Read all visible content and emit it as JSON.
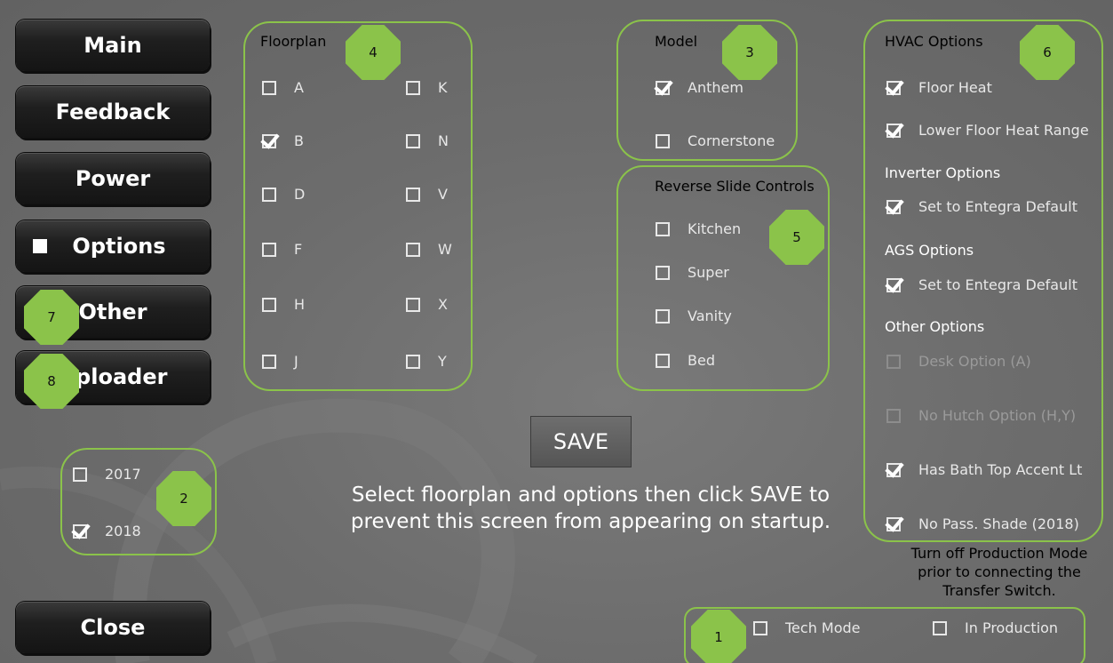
{
  "nav": {
    "main": "Main",
    "feedback": "Feedback",
    "power": "Power",
    "options": "Options",
    "other": "Other",
    "uploader": "Uploader",
    "close": "Close"
  },
  "badges": {
    "b1": "1",
    "b2": "2",
    "b3": "3",
    "b4": "4",
    "b5": "5",
    "b6": "6",
    "b7": "7",
    "b8": "8"
  },
  "year": {
    "items": [
      {
        "label": "2017",
        "checked": false
      },
      {
        "label": "2018",
        "checked": true
      }
    ]
  },
  "floorplan": {
    "title": "Floorplan",
    "items": [
      {
        "label": "A",
        "checked": false
      },
      {
        "label": "B",
        "checked": true
      },
      {
        "label": "D",
        "checked": false
      },
      {
        "label": "F",
        "checked": false
      },
      {
        "label": "H",
        "checked": false
      },
      {
        "label": "J",
        "checked": false
      },
      {
        "label": "K",
        "checked": false
      },
      {
        "label": "N",
        "checked": false
      },
      {
        "label": "V",
        "checked": false
      },
      {
        "label": "W",
        "checked": false
      },
      {
        "label": "X",
        "checked": false
      },
      {
        "label": "Y",
        "checked": false
      }
    ]
  },
  "model": {
    "title": "Model",
    "items": [
      {
        "label": "Anthem",
        "checked": true
      },
      {
        "label": "Cornerstone",
        "checked": false
      }
    ]
  },
  "reverse": {
    "title": "Reverse Slide Controls",
    "items": [
      {
        "label": "Kitchen",
        "checked": false
      },
      {
        "label": "Super",
        "checked": false
      },
      {
        "label": "Vanity",
        "checked": false
      },
      {
        "label": "Bed",
        "checked": false
      }
    ]
  },
  "hvac": {
    "title": "HVAC Options",
    "items": [
      {
        "label": "Floor Heat",
        "checked": true
      },
      {
        "label": "Lower Floor Heat Range",
        "checked": true
      }
    ]
  },
  "inverter": {
    "title": "Inverter Options",
    "items": [
      {
        "label": "Set to Entegra Default",
        "checked": true
      }
    ]
  },
  "ags": {
    "title": "AGS Options",
    "items": [
      {
        "label": "Set to Entegra Default",
        "checked": true
      }
    ]
  },
  "other_options": {
    "title": "Other Options",
    "items": [
      {
        "label": "Desk Option (A)",
        "checked": false,
        "disabled": true
      },
      {
        "label": "No Hutch Option (H,Y)",
        "checked": false,
        "disabled": true
      },
      {
        "label": "Has Bath Top Accent Lt",
        "checked": true,
        "disabled": false
      },
      {
        "label": "No Pass. Shade (2018)",
        "checked": true,
        "disabled": false
      }
    ]
  },
  "bottom": {
    "items": [
      {
        "label": "Tech Mode",
        "checked": false
      },
      {
        "label": "In Production",
        "checked": false
      }
    ]
  },
  "save_label": "SAVE",
  "instruction": "Select floorplan and options then click SAVE to prevent this screen from appearing on startup.",
  "warning": "Turn off Production Mode prior to connecting the Transfer Switch.",
  "colors": {
    "accent": "#8bc34a",
    "background": "#6f6f6f",
    "button": "#1f1f1f"
  }
}
